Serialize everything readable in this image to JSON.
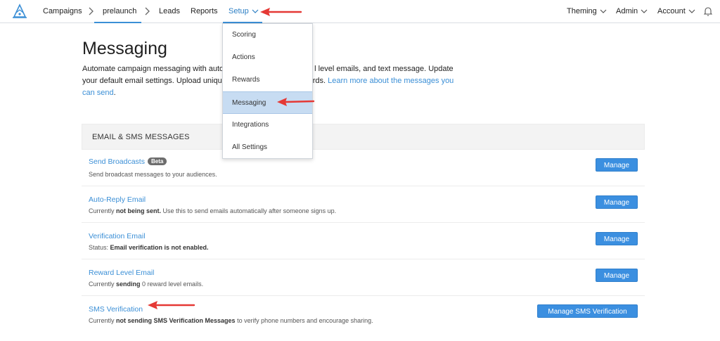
{
  "nav": {
    "campaigns": "Campaigns",
    "prelaunch": "prelaunch",
    "leads": "Leads",
    "reports": "Reports",
    "setup": "Setup",
    "theming": "Theming",
    "admin": "Admin",
    "account": "Account"
  },
  "dropdown": {
    "items": [
      "Scoring",
      "Actions",
      "Rewards",
      "Messaging",
      "Integrations",
      "All Settings"
    ],
    "selected": "Messaging"
  },
  "page": {
    "title": "Messaging",
    "desc_part1": "Automate campaign messaging with auto",
    "desc_part2": "l level emails, and text message. Update",
    "desc_line2_a": "your default email settings. Upload uniqu",
    "desc_line2_b": "rds.",
    "learn_more": "Learn more about the messages you",
    "learn_more_2": "can send",
    "desc_end": "."
  },
  "section": {
    "title": "EMAIL & SMS MESSAGES"
  },
  "rows": [
    {
      "title": "Send Broadcasts",
      "badge": "Beta",
      "sub_plain": "Send broadcast messages to your audiences.",
      "button": "Manage"
    },
    {
      "title": "Auto-Reply Email",
      "sub_pre": "Currently ",
      "sub_bold": "not being sent.",
      "sub_post": " Use this to send emails automatically after someone signs up.",
      "button": "Manage"
    },
    {
      "title": "Verification Email",
      "sub_pre": "Status: ",
      "sub_bold": "Email verification is not enabled.",
      "sub_post": "",
      "button": "Manage"
    },
    {
      "title": "Reward Level Email",
      "sub_pre": "Currently ",
      "sub_bold": "sending",
      "sub_post": " 0 reward level emails.",
      "button": "Manage"
    },
    {
      "title": "SMS Verification",
      "sub_pre": "Currently ",
      "sub_bold": "not sending SMS Verification Messages",
      "sub_post": " to verify phone numbers and encourage sharing.",
      "button": "Manage SMS Verification"
    }
  ],
  "colors": {
    "accent": "#3b8fd6",
    "button": "#3b8fe0",
    "dropdown_active": "#c7dcf2",
    "annotation": "#e53935"
  },
  "icons": [
    "app-logo-icon",
    "chevron-right-icon",
    "chevron-down-icon",
    "bell-icon",
    "red-arrow-annotation"
  ]
}
